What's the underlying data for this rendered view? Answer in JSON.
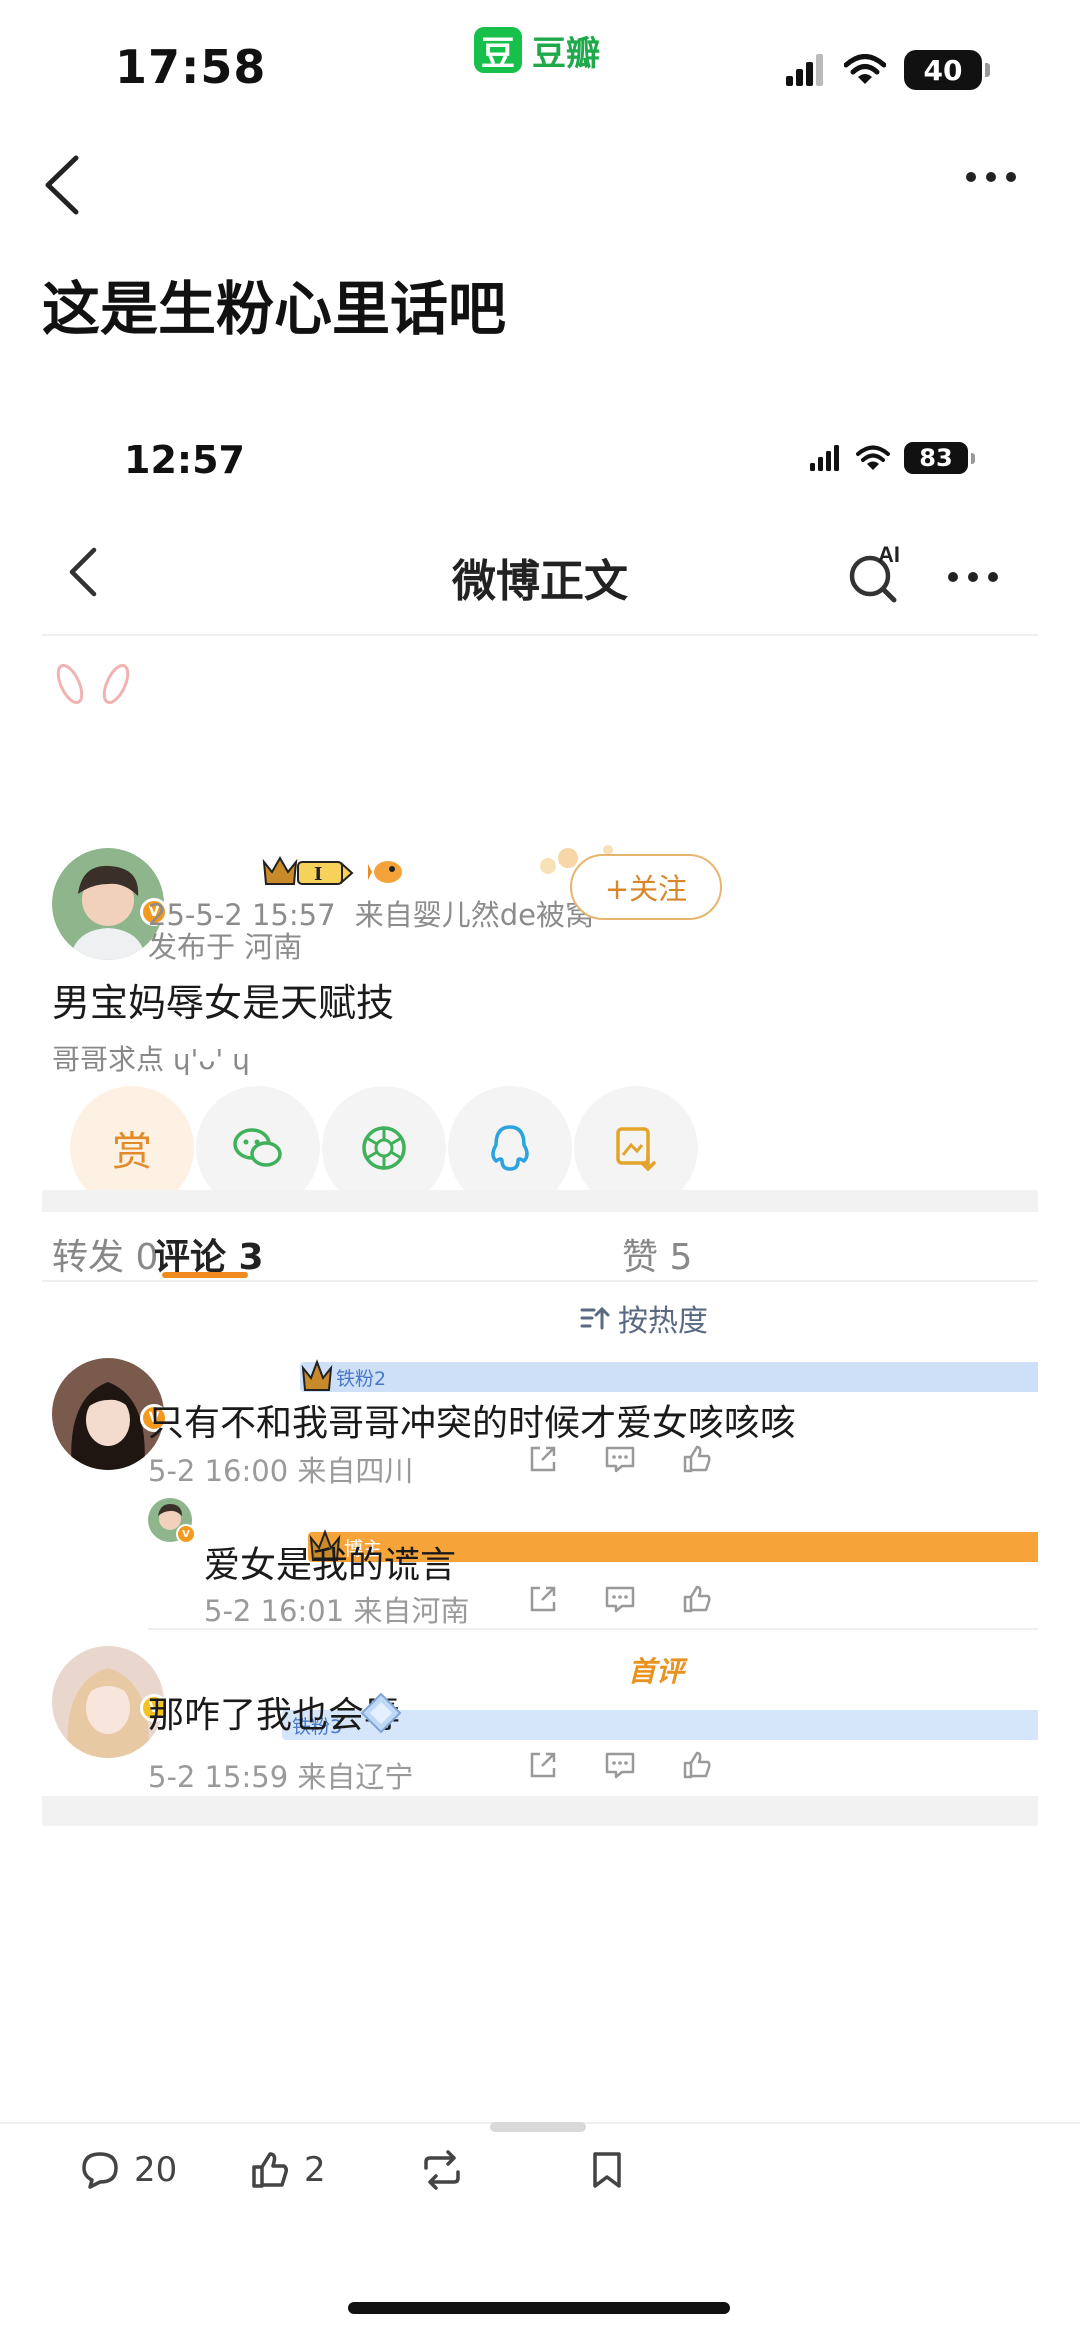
{
  "status_bar": {
    "time": "17:58",
    "app_name": "豆瓣",
    "app_logo_char": "豆",
    "battery": "40"
  },
  "header": {
    "title": "这是生粉心里话吧"
  },
  "embedded": {
    "status_bar": {
      "time": "12:57",
      "battery": "83"
    },
    "nav": {
      "title": "微博正文",
      "ai_label": "AI"
    },
    "post": {
      "timestamp": "25-5-2 15:57",
      "source": "来自婴儿然de被窝",
      "location": "发布于 河南",
      "follow_label": "+关注",
      "level_badge": "I",
      "content": "男宝妈辱女是天赋技",
      "hint": "哥哥求点 ɥ'ᴗ' ɥ",
      "reward_label": "赏"
    },
    "tabs": {
      "repost": "转发 0",
      "comments": "评论 3",
      "likes": "赞 5"
    },
    "sort_label": "按热度",
    "comments": [
      {
        "badge": "铁粉2",
        "text": "只有不和我哥哥冲突的时候才爱女咳咳咳",
        "meta": "5-2 16:00 来自四川",
        "reply": {
          "badge": "博主",
          "text": "爱女是我的谎言",
          "meta": "5-2 16:01 来自河南"
        }
      },
      {
        "badge": "铁粉3",
        "first_tag": "首评",
        "text": "那咋了我也会辱",
        "meta": "5-2 15:59 来自辽宁"
      }
    ]
  },
  "bottom_bar": {
    "comments": "20",
    "likes": "2"
  },
  "colors": {
    "accent": "#f08a1e",
    "douban_green": "#17c04a",
    "fan_blue": "#4a79c9"
  }
}
